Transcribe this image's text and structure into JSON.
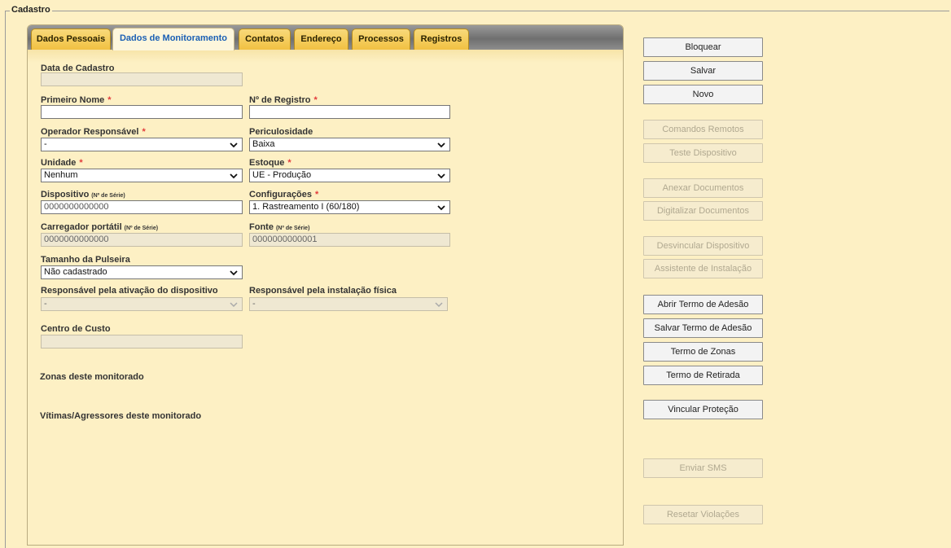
{
  "fieldset": {
    "legend": "Cadastro"
  },
  "tabs": [
    {
      "label": "Dados Pessoais",
      "active": false
    },
    {
      "label": "Dados de Monitoramento",
      "active": true
    },
    {
      "label": "Contatos",
      "active": false
    },
    {
      "label": "Endereço",
      "active": false
    },
    {
      "label": "Processos",
      "active": false
    },
    {
      "label": "Registros",
      "active": false
    }
  ],
  "form": {
    "data_cadastro": {
      "label": "Data de Cadastro",
      "value": ""
    },
    "primeiro_nome": {
      "label": "Primeiro Nome",
      "required": "*",
      "value": ""
    },
    "n_registro": {
      "label": "Nº de Registro",
      "required": "*",
      "value": ""
    },
    "operador": {
      "label": "Operador Responsável",
      "required": "*",
      "value": "-"
    },
    "periculosidade": {
      "label": "Periculosidade",
      "value": "Baixa"
    },
    "unidade": {
      "label": "Unidade",
      "required": "*",
      "value": "Nenhum"
    },
    "estoque": {
      "label": "Estoque",
      "required": "*",
      "value": "UE - Produção"
    },
    "dispositivo": {
      "label": "Dispositivo",
      "note": "(Nº de Série)",
      "value": "0000000000000"
    },
    "configuracoes": {
      "label": "Configurações",
      "required": "*",
      "value": "1. Rastreamento I (60/180)"
    },
    "carregador": {
      "label": "Carregador portátil",
      "note": "(Nº de Série)",
      "value": "0000000000000"
    },
    "fonte": {
      "label": "Fonte",
      "note": "(Nº de Série)",
      "value": "0000000000001"
    },
    "pulseira": {
      "label": "Tamanho da Pulseira",
      "value": "Não cadastrado"
    },
    "resp_ativacao": {
      "label": "Responsável pela ativação do dispositivo",
      "value": "-"
    },
    "resp_instalacao": {
      "label": "Responsável pela instalação física",
      "value": "-"
    },
    "centro_custo": {
      "label": "Centro de Custo",
      "value": ""
    }
  },
  "sections": {
    "zonas": "Zonas deste monitorado",
    "vitimas": "Vítimas/Agressores deste monitorado"
  },
  "buttons": {
    "bloquear": "Bloquear",
    "salvar": "Salvar",
    "novo": "Novo",
    "comandos_remotos": "Comandos Remotos",
    "teste_dispositivo": "Teste Dispositivo",
    "anexar_documentos": "Anexar Documentos",
    "digitalizar_documentos": "Digitalizar Documentos",
    "desvincular_dispositivo": "Desvincular Dispositivo",
    "assistente_instalacao": "Assistente de Instalação",
    "abrir_termo": "Abrir Termo de Adesão",
    "salvar_termo": "Salvar Termo de Adesão",
    "termo_zonas": "Termo de Zonas",
    "termo_retirada": "Termo de Retirada",
    "vincular_protecao": "Vincular Proteção",
    "enviar_sms": "Enviar SMS",
    "resetar_violacoes": "Resetar Violações"
  }
}
